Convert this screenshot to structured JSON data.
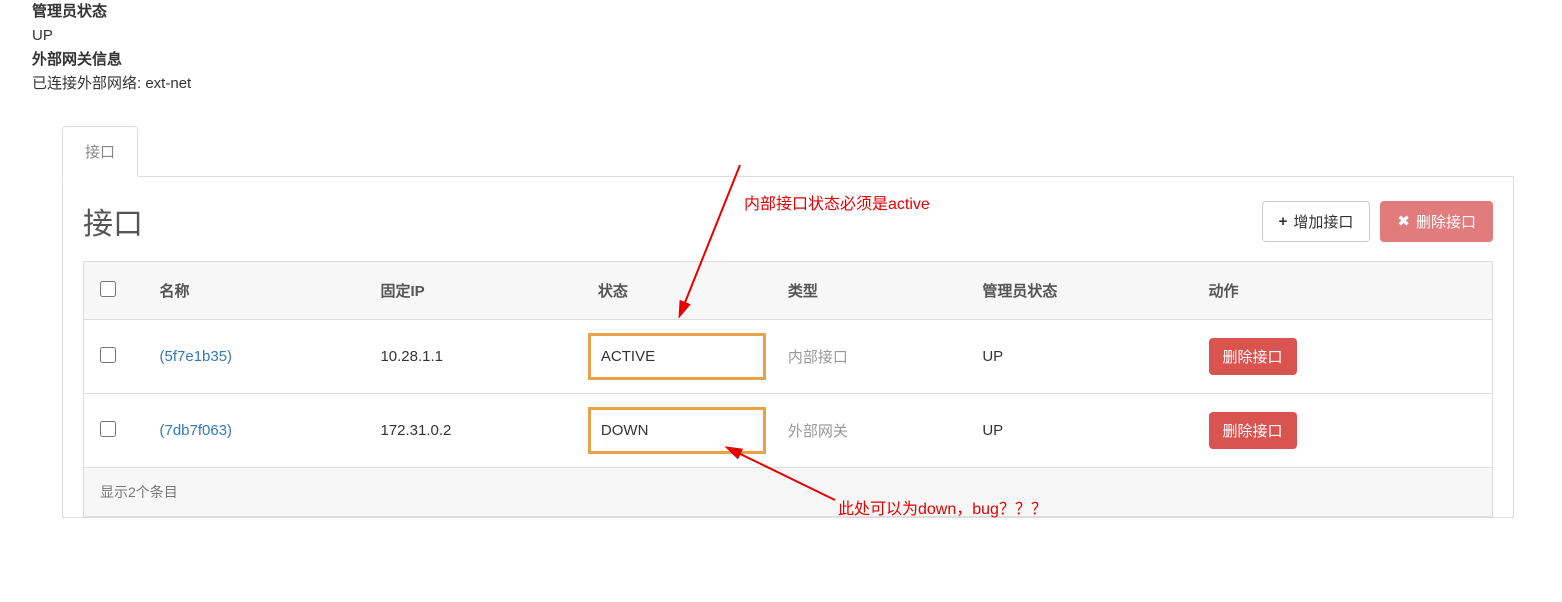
{
  "top_info": {
    "admin_status_label": "管理员状态",
    "admin_status_value": "UP",
    "ext_gateway_label": "外部网关信息",
    "ext_network_prefix": "已连接外部网络: ",
    "ext_network_value": "ext-net"
  },
  "tabs": {
    "active_label": "接口"
  },
  "panel": {
    "title": "接口",
    "add_button": "增加接口",
    "delete_button": "删除接口"
  },
  "table": {
    "headers": {
      "name": "名称",
      "fixed_ip": "固定IP",
      "status": "状态",
      "type": "类型",
      "admin_status": "管理员状态",
      "action": "动作"
    },
    "rows": [
      {
        "name": "(5f7e1b35)",
        "fixed_ip": "10.28.1.1",
        "status": "ACTIVE",
        "type": "内部接口",
        "admin_status": "UP",
        "action_label": "删除接口"
      },
      {
        "name": "(7db7f063)",
        "fixed_ip": "172.31.0.2",
        "status": "DOWN",
        "type": "外部网关",
        "admin_status": "UP",
        "action_label": "删除接口"
      }
    ],
    "footer": "显示2个条目"
  },
  "annotations": {
    "top": "内部接口状态必须是active",
    "bottom": "此处可以为down，bug？？？"
  },
  "icons": {
    "plus": "+",
    "close": "✖"
  }
}
